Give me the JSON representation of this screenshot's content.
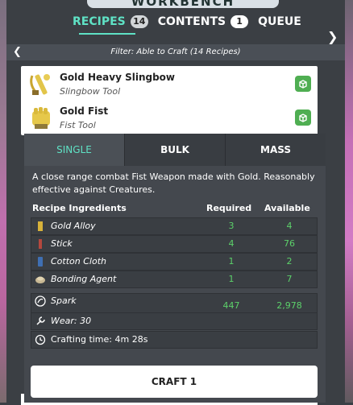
{
  "title": "WORKBENCH",
  "tabs": [
    {
      "label": "RECIPES",
      "count": "14"
    },
    {
      "label": "CONTENTS",
      "count": "1"
    },
    {
      "label": "QUEUE"
    }
  ],
  "filter": "Filter: Able to Craft (14 Recipes)",
  "recipes": [
    {
      "name": "Gold Heavy Slingbow",
      "type": "Slingbow Tool"
    },
    {
      "name": "Gold Fist",
      "type": "Fist Tool"
    }
  ],
  "modes": [
    "SINGLE",
    "BULK",
    "MASS"
  ],
  "description": "A close range combat Fist Weapon made with Gold. Reasonably effective against Creatures.",
  "table": {
    "col_ingredients": "Recipe Ingredients",
    "col_required": "Required",
    "col_available": "Available",
    "ingredients": [
      {
        "name": "Gold Alloy",
        "required": "3",
        "available": "4",
        "icon": "gold-alloy-icon",
        "color": "#d7b23a"
      },
      {
        "name": "Stick",
        "required": "4",
        "available": "76",
        "icon": "stick-icon",
        "color": "#b5483e"
      },
      {
        "name": "Cotton Cloth",
        "required": "1",
        "available": "2",
        "icon": "cotton-cloth-icon",
        "color": "#3f6fb3"
      },
      {
        "name": "Bonding Agent",
        "required": "1",
        "available": "7",
        "icon": "bonding-agent-icon",
        "color": "#c8b894"
      }
    ]
  },
  "spark": {
    "label": "Spark",
    "required": "447",
    "available": "2,978"
  },
  "wear": "Wear: 30",
  "crafting_time": "Crafting time: 4m 28s",
  "craft_button": "CRAFT 1",
  "colors": {
    "accent": "#5fe2c5",
    "ok": "#5cd16a",
    "add_button": "#4fae52"
  }
}
